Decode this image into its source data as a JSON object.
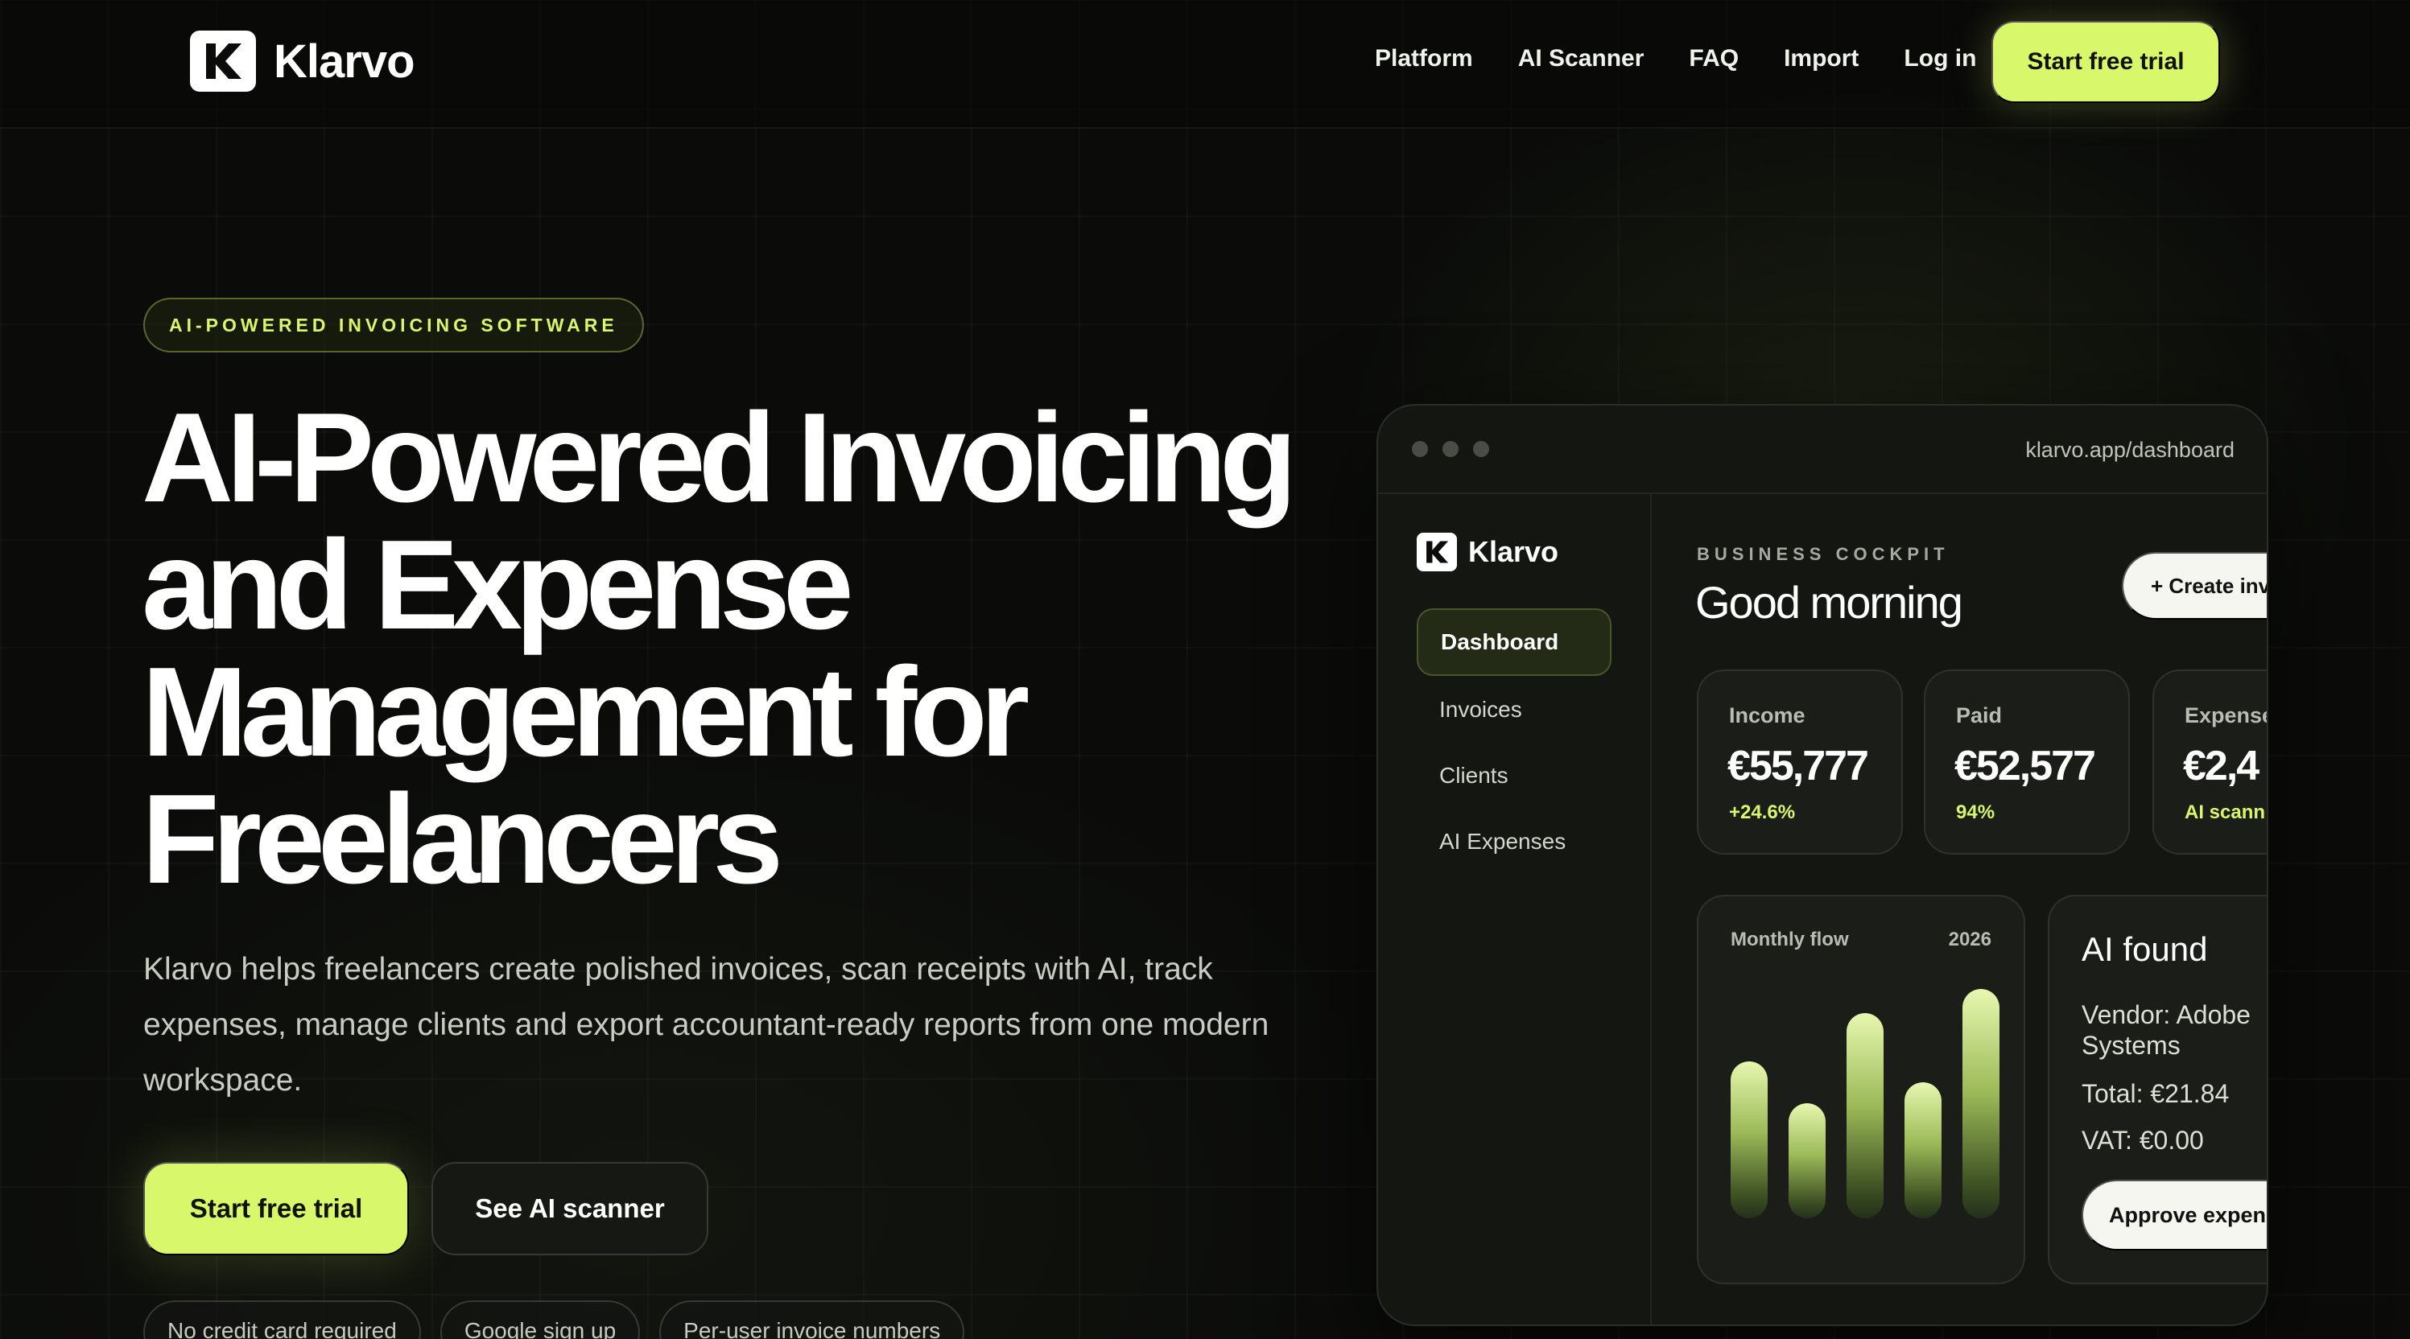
{
  "nav": {
    "brand": "Klarvo",
    "links": [
      "Platform",
      "AI Scanner",
      "FAQ",
      "Import",
      "Log in"
    ],
    "cta": "Start free trial"
  },
  "hero": {
    "badge": "AI-POWERED INVOICING SOFTWARE",
    "title_lines": [
      "AI-Powered Invoicing",
      "and Expense",
      "Management for",
      "Freelancers"
    ],
    "description": "Klarvo helps freelancers create polished invoices, scan receipts with AI, track expenses, manage clients and export accountant-ready reports from one modern workspace.",
    "primary_button": "Start free trial",
    "secondary_button": "See AI scanner",
    "chips": [
      "No credit card required",
      "Google sign up",
      "Per-user invoice numbers"
    ]
  },
  "dashboard": {
    "url": "klarvo.app/dashboard",
    "brand": "Klarvo",
    "sidebar": [
      "Dashboard",
      "Invoices",
      "Clients",
      "AI Expenses"
    ],
    "eyebrow": "BUSINESS COCKPIT",
    "greeting": "Good morning",
    "create_button": "+ Create inv",
    "stats": [
      {
        "label": "Income",
        "value": "€55,777",
        "sub": "+24.6%"
      },
      {
        "label": "Paid",
        "value": "€52,577",
        "sub": "94%"
      },
      {
        "label": "Expense",
        "value": "€2,4",
        "sub": "AI scann"
      }
    ],
    "flow": {
      "label": "Monthly flow",
      "year": "2026",
      "bar_levels": [
        0.52,
        0.38,
        0.68,
        0.45,
        0.76
      ]
    },
    "ai": {
      "title": "AI found",
      "vendor": "Vendor: Adobe Systems",
      "total": "Total: €21.84",
      "vat": "VAT: €0.00",
      "approve": "Approve expens"
    }
  },
  "colors": {
    "accent": "#d9f76b",
    "background": "#0b0c0a",
    "card": "#1b1e18"
  }
}
